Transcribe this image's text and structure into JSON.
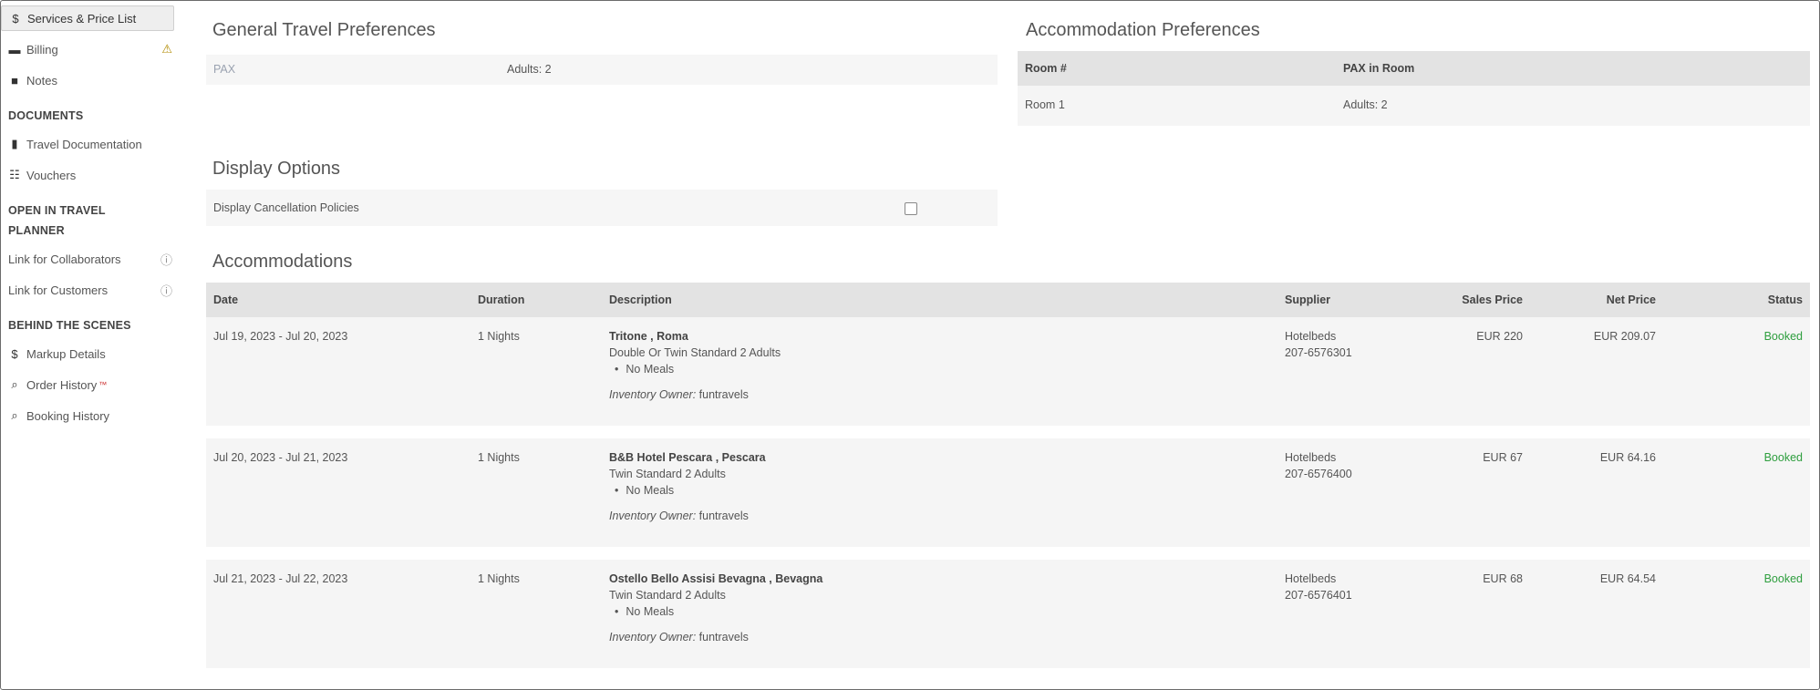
{
  "sidebar": {
    "items": [
      {
        "label": "Services & Price List",
        "icon": "dollar-icon",
        "glyph": "$"
      },
      {
        "label": "Billing",
        "icon": "billing-icon",
        "glyph": "▬",
        "badge": "⚠"
      },
      {
        "label": "Notes",
        "icon": "notes-icon",
        "glyph": "■"
      }
    ],
    "documents_title": "DOCUMENTS",
    "documents": [
      {
        "label": "Travel Documentation",
        "icon": "book-icon",
        "glyph": "▮"
      },
      {
        "label": "Vouchers",
        "icon": "vouchers-icon",
        "glyph": "☷"
      }
    ],
    "travel_planner_title": "OPEN IN TRAVEL PLANNER",
    "travel_planner": [
      {
        "label": "Link for Collaborators",
        "info": "ⓘ"
      },
      {
        "label": "Link for Customers",
        "info": "ⓘ"
      }
    ],
    "behind_title": "BEHIND THE SCENES",
    "behind": [
      {
        "label": "Markup Details",
        "icon": "dollar-icon",
        "glyph": "$"
      },
      {
        "label": "Order History",
        "icon": "search-icon",
        "glyph": "⌕",
        "sup": "™"
      },
      {
        "label": "Booking History",
        "icon": "search-icon",
        "glyph": "⌕"
      }
    ]
  },
  "travel_prefs": {
    "title": "General Travel Preferences",
    "pax_label": "PAX",
    "pax_value": "Adults: 2"
  },
  "accommodation_prefs": {
    "title": "Accommodation Preferences",
    "headers": [
      "Room #",
      "PAX in Room"
    ],
    "rows": [
      {
        "room": "Room 1",
        "pax": "Adults: 2"
      }
    ]
  },
  "display_options": {
    "title": "Display Options",
    "cancellation_label": "Display Cancellation Policies",
    "cancellation_checked": false
  },
  "accommodations": {
    "title": "Accommodations",
    "headers": {
      "date": "Date",
      "duration": "Duration",
      "description": "Description",
      "supplier": "Supplier",
      "sales_price": "Sales Price",
      "net_price": "Net Price",
      "status": "Status"
    },
    "owner_label": "Inventory Owner:",
    "rows": [
      {
        "date": "Jul 19, 2023 - Jul 20, 2023",
        "duration": "1 Nights",
        "hotel": "Tritone , Roma",
        "room": "Double Or Twin Standard 2 Adults",
        "meal": "No Meals",
        "owner": "funtravels",
        "supplier": "Hotelbeds",
        "supplier_id": "207-6576301",
        "sales_price": "EUR 220",
        "net_price": "EUR 209.07",
        "status": "Booked"
      },
      {
        "date": "Jul 20, 2023 - Jul 21, 2023",
        "duration": "1 Nights",
        "hotel": "B&B Hotel Pescara , Pescara",
        "room": "Twin Standard 2 Adults",
        "meal": "No Meals",
        "owner": "funtravels",
        "supplier": "Hotelbeds",
        "supplier_id": "207-6576400",
        "sales_price": "EUR 67",
        "net_price": "EUR 64.16",
        "status": "Booked"
      },
      {
        "date": "Jul 21, 2023 - Jul 22, 2023",
        "duration": "1 Nights",
        "hotel": "Ostello Bello Assisi Bevagna , Bevagna",
        "room": "Twin Standard 2 Adults",
        "meal": "No Meals",
        "owner": "funtravels",
        "supplier": "Hotelbeds",
        "supplier_id": "207-6576401",
        "sales_price": "EUR 68",
        "net_price": "EUR 64.54",
        "status": "Booked"
      }
    ]
  }
}
